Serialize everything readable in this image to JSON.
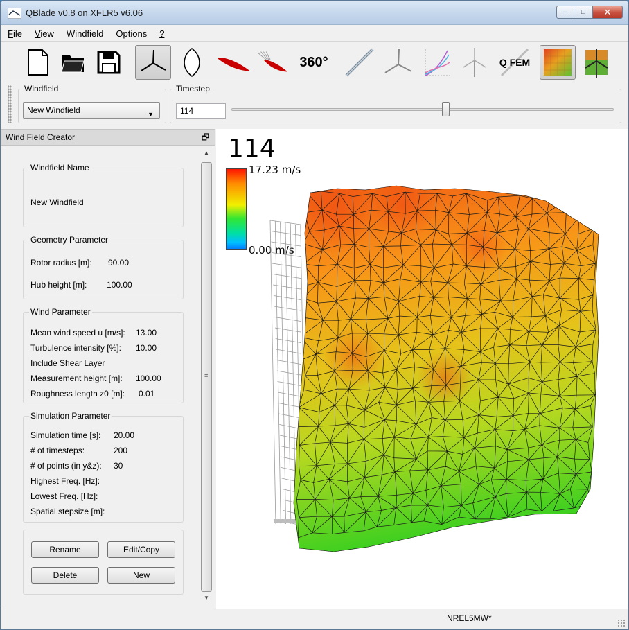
{
  "window": {
    "title": "QBlade v0.8 on XFLR5 v6.06",
    "min_glyph": "–",
    "max_glyph": "□",
    "close_glyph": "✕"
  },
  "menu": {
    "items": [
      {
        "label": "File",
        "accel": "F"
      },
      {
        "label": "View",
        "accel": "V"
      },
      {
        "label": "Windfield",
        "accel": ""
      },
      {
        "label": "Options",
        "accel": ""
      },
      {
        "label": "?",
        "accel": "?"
      }
    ]
  },
  "toolbar": {
    "text_360": "360°",
    "text_qfem": "Q FEM",
    "icons": [
      "new-file-icon",
      "open-folder-icon",
      "save-icon",
      "windfield-icon",
      "airfoil-icon",
      "blade-icon",
      "blade-design-icon",
      "polar-360-icon",
      "bem-icon",
      "rotor-icon",
      "multi-bem-icon",
      "turbine-icon",
      "qfem-icon",
      "windfield-module-icon",
      "turbine-sim-icon"
    ]
  },
  "params": {
    "windfield_label": "Windfield",
    "windfield_selected": "New Windfield",
    "timestep_label": "Timestep",
    "timestep_value": "114",
    "timestep_current": 114,
    "timestep_max": 200
  },
  "dock": {
    "title": "Wind Field Creator",
    "name_group": {
      "title": "Windfield Name",
      "value": "New Windfield"
    },
    "geometry_group": {
      "title": "Geometry Parameter",
      "rotor_radius_label": "Rotor radius [m]:",
      "rotor_radius_value": "90.00",
      "hub_height_label": "Hub height [m]:",
      "hub_height_value": "100.00"
    },
    "wind_group": {
      "title": "Wind Parameter",
      "mean_speed_label": "Mean wind speed u [m/s]:",
      "mean_speed_value": "13.00",
      "turbulence_label": "Turbulence intensity [%]:",
      "turbulence_value": "10.00",
      "shear_label": "Include Shear Layer",
      "meas_height_label": "Measurement height [m]:",
      "meas_height_value": "100.00",
      "roughness_label": "Roughness length z0 [m]:",
      "roughness_value": "0.01"
    },
    "sim_group": {
      "title": "Simulation Parameter",
      "sim_time_label": "Simulation time [s]:",
      "sim_time_value": "20.00",
      "timesteps_label": "# of timesteps:",
      "timesteps_value": "200",
      "points_label": "# of points (in y&z):",
      "points_value": "30",
      "highest_freq_label": "Highest Freq. [Hz]:",
      "lowest_freq_label": "Lowest Freq. [Hz]:",
      "stepsize_label": "Spatial stepsize [m]:"
    },
    "buttons": {
      "rename": "Rename",
      "edit_copy": "Edit/Copy",
      "delete": "Delete",
      "new": "New"
    }
  },
  "viewport": {
    "timestep_display": "114",
    "colorbar_max": "17.23 m/s",
    "colorbar_min": "0.00 m/s"
  },
  "status": {
    "project": "NREL5MW*"
  }
}
